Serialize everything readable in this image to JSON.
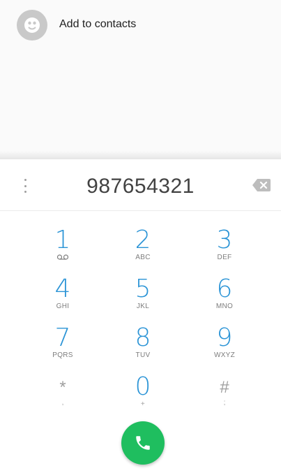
{
  "suggestions": {
    "add_to_contacts_label": "Add to contacts",
    "avatar_icon": "person-icon"
  },
  "dialpad": {
    "entered_number": "987654321",
    "overflow_icon": "more-vert-icon",
    "backspace_icon": "backspace-icon",
    "keys": [
      {
        "digit": "1",
        "letters": ""
      },
      {
        "digit": "2",
        "letters": "ABC"
      },
      {
        "digit": "3",
        "letters": "DEF"
      },
      {
        "digit": "4",
        "letters": "GHI"
      },
      {
        "digit": "5",
        "letters": "JKL"
      },
      {
        "digit": "6",
        "letters": "MNO"
      },
      {
        "digit": "7",
        "letters": "PQRS"
      },
      {
        "digit": "8",
        "letters": "TUV"
      },
      {
        "digit": "9",
        "letters": "WXYZ"
      },
      {
        "digit": "*",
        "letters": ","
      },
      {
        "digit": "0",
        "letters": "+"
      },
      {
        "digit": "#",
        "letters": ";"
      }
    ],
    "call_button_icon": "phone-icon"
  },
  "colors": {
    "digit_blue": "#2b94d6",
    "call_green": "#1fbe5f",
    "avatar_gray": "#c9c9c9"
  }
}
